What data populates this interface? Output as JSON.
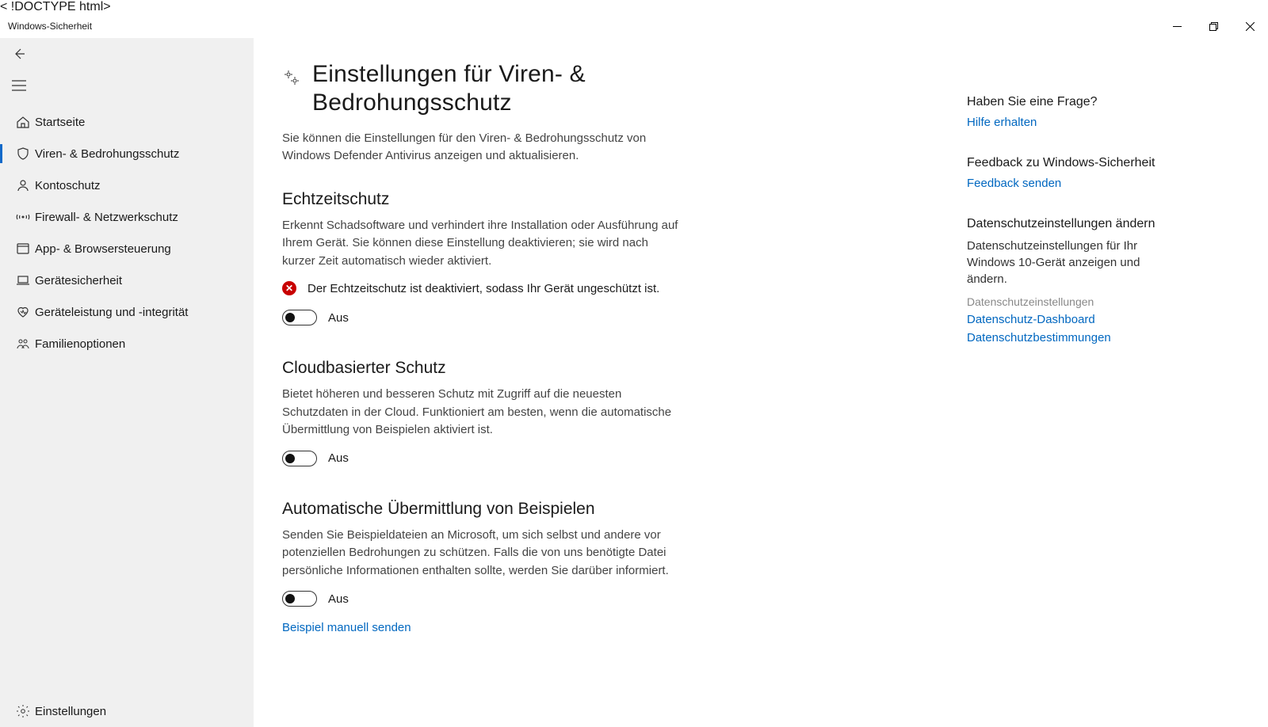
{
  "app_title": "Windows-Sicherheit",
  "sidebar": {
    "items": [
      {
        "icon": "home",
        "label": "Startseite"
      },
      {
        "icon": "shield",
        "label": "Viren- & Bedrohungsschutz",
        "selected": true
      },
      {
        "icon": "person",
        "label": "Kontoschutz"
      },
      {
        "icon": "signal",
        "label": "Firewall- & Netzwerkschutz"
      },
      {
        "icon": "square",
        "label": "App- & Browsersteuerung"
      },
      {
        "icon": "laptop",
        "label": "Gerätesicherheit"
      },
      {
        "icon": "heart",
        "label": "Geräteleistung und -integrität"
      },
      {
        "icon": "family",
        "label": "Familienoptionen"
      }
    ],
    "settings_label": "Einstellungen"
  },
  "page": {
    "title": "Einstellungen für Viren- & Bedrohungsschutz",
    "subtitle": "Sie können die Einstellungen für den Viren- & Bedrohungsschutz von Windows Defender Antivirus anzeigen und aktualisieren."
  },
  "sections": {
    "rt": {
      "title": "Echtzeitschutz",
      "desc": "Erkennt Schadsoftware und verhindert ihre Installation oder Ausführung auf Ihrem Gerät. Sie können diese Einstellung deaktivieren; sie wird nach kurzer Zeit automatisch wieder aktiviert.",
      "warn": "Der Echtzeitschutz ist deaktiviert, sodass Ihr Gerät ungeschützt ist.",
      "state": "Aus"
    },
    "cloud": {
      "title": "Cloudbasierter Schutz",
      "desc": "Bietet höheren und besseren Schutz mit Zugriff auf die neuesten Schutzdaten in der Cloud. Funktioniert am besten, wenn die automatische Übermittlung von Beispielen aktiviert ist.",
      "state": "Aus"
    },
    "sample": {
      "title": "Automatische Übermittlung von Beispielen",
      "desc": "Senden Sie Beispieldateien an Microsoft, um sich selbst und andere vor potenziellen Bedrohungen zu schützen. Falls die von uns benötigte Datei persönliche Informationen enthalten sollte, werden Sie darüber informiert.",
      "state": "Aus",
      "link": "Beispiel manuell senden"
    }
  },
  "right": {
    "q": {
      "title": "Haben Sie eine Frage?",
      "link": "Hilfe erhalten"
    },
    "fb": {
      "title": "Feedback zu Windows-Sicherheit",
      "link": "Feedback senden"
    },
    "pr": {
      "title": "Datenschutzeinstellungen ändern",
      "desc": "Datenschutzeinstellungen für Ihr Windows 10-Gerät anzeigen und ändern.",
      "muted": "Datenschutzeinstellungen",
      "l1": "Datenschutz-Dashboard",
      "l2": "Datenschutzbestimmungen"
    }
  }
}
